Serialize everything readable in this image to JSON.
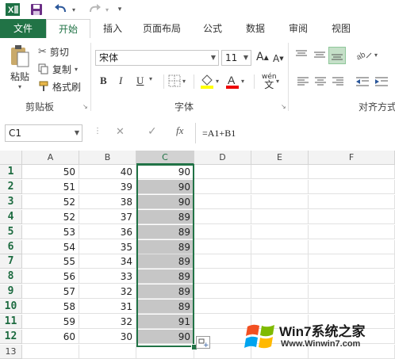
{
  "qat": {
    "app_icon": "excel-icon",
    "save_icon": "save-icon",
    "undo_icon": "undo-icon",
    "redo_icon": "redo-icon"
  },
  "tabs": [
    {
      "label": "文件"
    },
    {
      "label": "开始"
    },
    {
      "label": "插入"
    },
    {
      "label": "页面布局"
    },
    {
      "label": "公式"
    },
    {
      "label": "数据"
    },
    {
      "label": "审阅"
    },
    {
      "label": "视图"
    }
  ],
  "clipboard": {
    "paste": "粘贴",
    "cut": "剪切",
    "copy": "复制",
    "format_painter": "格式刷",
    "group": "剪贴板"
  },
  "font": {
    "name": "宋体",
    "size": "11",
    "bold": "B",
    "italic": "I",
    "underline": "U",
    "wen": "wén",
    "wen_char": "文",
    "group": "字体"
  },
  "alignment": {
    "group": "对齐方式"
  },
  "formula_bar": {
    "name_box": "C1",
    "cancel": "✕",
    "enter": "✓",
    "fx": "fx",
    "formula": "=A1+B1"
  },
  "grid": {
    "columns": [
      "A",
      "B",
      "C",
      "D",
      "E",
      "F"
    ],
    "rows": [
      {
        "n": "1",
        "a": "50",
        "b": "40",
        "c": "90"
      },
      {
        "n": "2",
        "a": "51",
        "b": "39",
        "c": "90"
      },
      {
        "n": "3",
        "a": "52",
        "b": "38",
        "c": "90"
      },
      {
        "n": "4",
        "a": "52",
        "b": "37",
        "c": "89"
      },
      {
        "n": "5",
        "a": "53",
        "b": "36",
        "c": "89"
      },
      {
        "n": "6",
        "a": "54",
        "b": "35",
        "c": "89"
      },
      {
        "n": "7",
        "a": "55",
        "b": "34",
        "c": "89"
      },
      {
        "n": "8",
        "a": "56",
        "b": "33",
        "c": "89"
      },
      {
        "n": "9",
        "a": "57",
        "b": "32",
        "c": "89"
      },
      {
        "n": "10",
        "a": "58",
        "b": "31",
        "c": "89"
      },
      {
        "n": "11",
        "a": "59",
        "b": "32",
        "c": "91"
      },
      {
        "n": "12",
        "a": "60",
        "b": "30",
        "c": "90"
      },
      {
        "n": "13",
        "a": "",
        "b": "",
        "c": ""
      }
    ]
  },
  "watermark": {
    "brand": "Win7系统之家",
    "url": "Www.Winwin7.com"
  },
  "colors": {
    "accent": "#217346",
    "selection": "#c6c6c6"
  }
}
